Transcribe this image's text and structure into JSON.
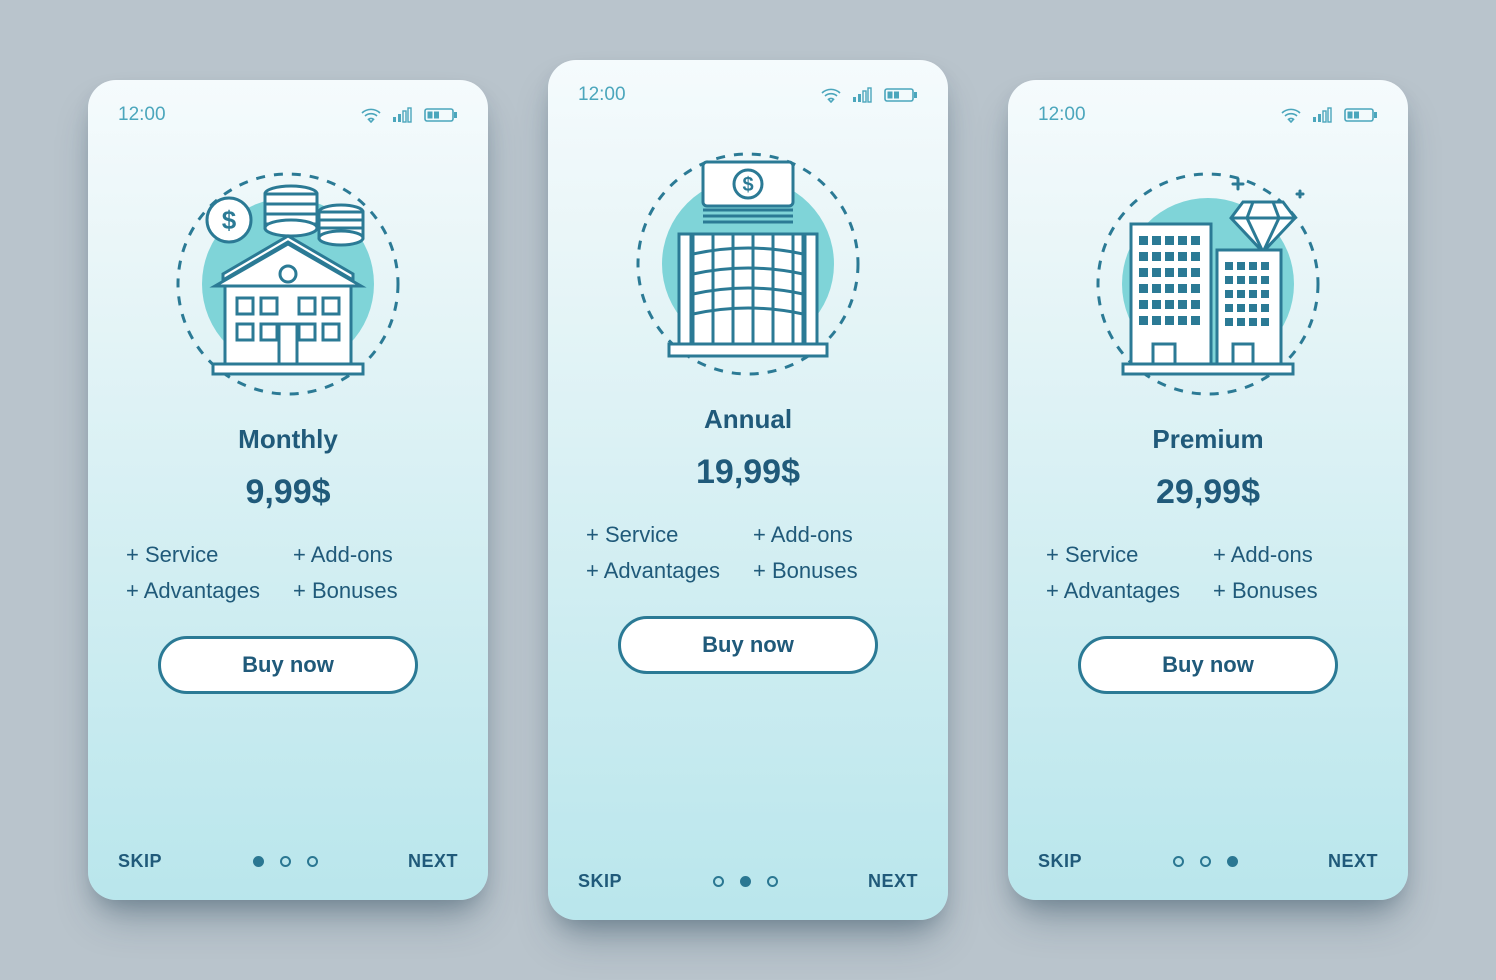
{
  "status": {
    "time": "12:00",
    "wifi_icon": "wifi-icon",
    "signal_icon": "signal-icon",
    "battery_icon": "battery-icon"
  },
  "plans": [
    {
      "title": "Monthly",
      "price": "9,99$",
      "features": [
        "+ Service",
        "+ Add-ons",
        "+ Advantages",
        "+ Bonuses"
      ],
      "cta": "Buy now",
      "skip": "SKIP",
      "next": "NEXT",
      "active_dot": 0
    },
    {
      "title": "Annual",
      "price": "19,99$",
      "features": [
        "+ Service",
        "+ Add-ons",
        "+ Advantages",
        "+ Bonuses"
      ],
      "cta": "Buy now",
      "skip": "SKIP",
      "next": "NEXT",
      "active_dot": 1
    },
    {
      "title": "Premium",
      "price": "29,99$",
      "features": [
        "+ Service",
        "+ Add-ons",
        "+ Advantages",
        "+ Bonuses"
      ],
      "cta": "Buy now",
      "skip": "SKIP",
      "next": "NEXT",
      "active_dot": 2
    }
  ]
}
